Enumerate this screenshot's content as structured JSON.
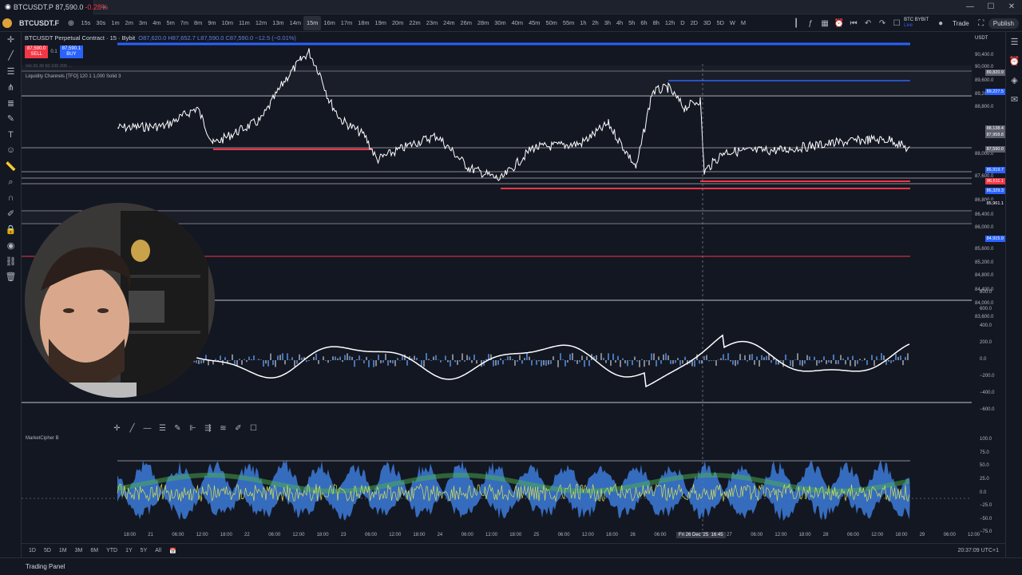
{
  "browser_tab": {
    "title": "BTCUSDT.P",
    "price": "87,590.0",
    "change": "-0.28%"
  },
  "toolbar": {
    "symbol": "BTCUSDT.F",
    "timeframes": [
      "15s",
      "30s",
      "1m",
      "2m",
      "3m",
      "4m",
      "5m",
      "7m",
      "8m",
      "9m",
      "10m",
      "11m",
      "12m",
      "13m",
      "14m",
      "15m",
      "16m",
      "17m",
      "18m",
      "19m",
      "20m",
      "22m",
      "23m",
      "24m",
      "26m",
      "28m",
      "30m",
      "40m",
      "45m",
      "50m",
      "55m",
      "1h",
      "2h",
      "3h",
      "4h",
      "5h",
      "6h",
      "8h",
      "12h",
      "D",
      "2D",
      "3D",
      "5D",
      "W",
      "M"
    ],
    "active_timeframe": "15m",
    "broker": "BTC BYBIT",
    "broker_sub": "Live",
    "trade_label": "Trade",
    "publish_label": "Publish"
  },
  "legend": {
    "symbol_title": "BTCUSDT Perpetual Contract · 15 · Bybit",
    "ohlc": "O87,620.0 H87,652.7 L87,590.0 C87,590.0 −12.5 (−0.01%)",
    "sell_price": "87,590.0",
    "sell_label": "SELL",
    "spread": "0.1",
    "buy_price": "87,590.1",
    "buy_label": "BUY",
    "indicator_small": "Vol 20 30 50 100 200 ...",
    "indicator1": "Liquidity Channels [TFO] 120 1 1,000 Solid 3",
    "indicator2": "MarketCipher B"
  },
  "price_axis": {
    "currency": "USDT",
    "labels": [
      "90,400.0",
      "90,000.0",
      "89,600.0",
      "89,200.0",
      "88,800.0",
      "88,000.0",
      "87,600.0",
      "86,800.0",
      "86,400.0",
      "86,000.0",
      "85,600.0",
      "85,200.0",
      "84,800.0",
      "84,400.0",
      "84,000.0",
      "83,600.0"
    ],
    "tag_labels": [
      {
        "text": "89,820.9",
        "color": "#5d606b"
      },
      {
        "text": "89,227.5",
        "color": "#2962ff"
      },
      {
        "text": "88,138.4",
        "color": "#5d606b"
      },
      {
        "text": "87,958.8",
        "color": "#5d606b"
      },
      {
        "text": "87,590.0",
        "color": "#5d606b"
      },
      {
        "text": "86,919.7",
        "color": "#2962ff"
      },
      {
        "text": "86,611.1",
        "color": "#f23645"
      },
      {
        "text": "86,329.3",
        "color": "#2962ff"
      },
      {
        "text": "85,961.1",
        "color": "#131722"
      },
      {
        "text": "84,915.9",
        "color": "#2962ff"
      }
    ]
  },
  "osc_axis": {
    "labels": [
      "800.0",
      "600.0",
      "400.0",
      "200.0",
      "0.0",
      "−200.0",
      "−400.0",
      "−600.0"
    ]
  },
  "mcb_axis": {
    "labels": [
      "100.0",
      "75.0",
      "50.0",
      "25.0",
      "0.0",
      "−25.0",
      "−50.0",
      "−75.0"
    ]
  },
  "time_axis": {
    "labels": [
      "18:00",
      "21",
      "06:00",
      "12:00",
      "18:00",
      "22",
      "06:00",
      "12:00",
      "18:00",
      "23",
      "06:00",
      "12:00",
      "18:00",
      "24",
      "06:00",
      "12:00",
      "18:00",
      "25",
      "06:00",
      "12:00",
      "18:00",
      "26",
      "06:00",
      "12:00",
      "18:00",
      "27",
      "06:00",
      "12:00",
      "18:00",
      "28",
      "06:00",
      "12:00",
      "18:00",
      "29",
      "06:00",
      "12:00"
    ],
    "crosshair_date": "Fri 26 Dec '25",
    "crosshair_time": "16:45"
  },
  "bottom_bar": {
    "ranges": [
      "1D",
      "5D",
      "1M",
      "3M",
      "6M",
      "YTD",
      "1Y",
      "5Y",
      "All"
    ],
    "clock": "20:37:09 UTC+1"
  },
  "footer": {
    "panel_label": "Trading Panel"
  },
  "colors": {
    "background": "#131722",
    "accent": "#2962ff",
    "red": "#f23645",
    "price": "#ffffff",
    "histo": "#3d7bd9"
  }
}
